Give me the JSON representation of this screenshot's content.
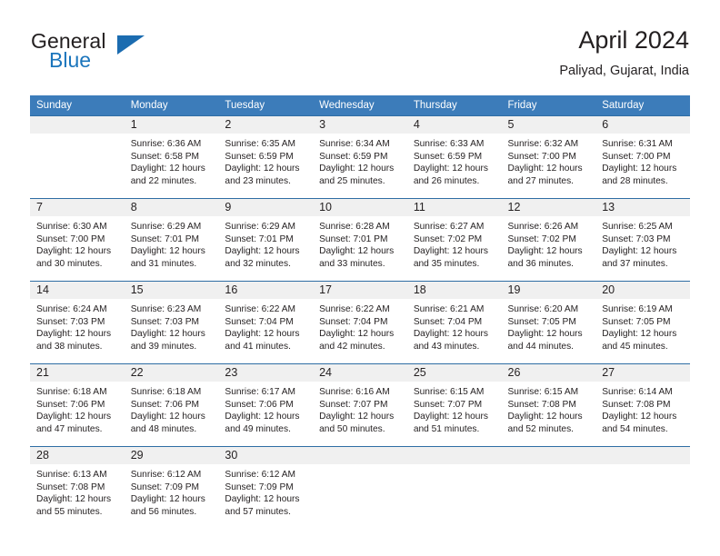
{
  "brand": {
    "name_part1": "General",
    "name_part2": "Blue",
    "logo_icon": "triangle-flag-icon"
  },
  "header": {
    "title": "April 2024",
    "subtitle": "Paliyad, Gujarat, India"
  },
  "calendar": {
    "weekday_headers": [
      "Sunday",
      "Monday",
      "Tuesday",
      "Wednesday",
      "Thursday",
      "Friday",
      "Saturday"
    ],
    "accent_color": "#3c7cba",
    "rule_color": "#2e6da4",
    "daynum_bg": "#f0f0f0",
    "weeks": [
      [
        {
          "day": "",
          "lines": []
        },
        {
          "day": "1",
          "lines": [
            "Sunrise: 6:36 AM",
            "Sunset: 6:58 PM",
            "Daylight: 12 hours",
            "and 22 minutes."
          ]
        },
        {
          "day": "2",
          "lines": [
            "Sunrise: 6:35 AM",
            "Sunset: 6:59 PM",
            "Daylight: 12 hours",
            "and 23 minutes."
          ]
        },
        {
          "day": "3",
          "lines": [
            "Sunrise: 6:34 AM",
            "Sunset: 6:59 PM",
            "Daylight: 12 hours",
            "and 25 minutes."
          ]
        },
        {
          "day": "4",
          "lines": [
            "Sunrise: 6:33 AM",
            "Sunset: 6:59 PM",
            "Daylight: 12 hours",
            "and 26 minutes."
          ]
        },
        {
          "day": "5",
          "lines": [
            "Sunrise: 6:32 AM",
            "Sunset: 7:00 PM",
            "Daylight: 12 hours",
            "and 27 minutes."
          ]
        },
        {
          "day": "6",
          "lines": [
            "Sunrise: 6:31 AM",
            "Sunset: 7:00 PM",
            "Daylight: 12 hours",
            "and 28 minutes."
          ]
        }
      ],
      [
        {
          "day": "7",
          "lines": [
            "Sunrise: 6:30 AM",
            "Sunset: 7:00 PM",
            "Daylight: 12 hours",
            "and 30 minutes."
          ]
        },
        {
          "day": "8",
          "lines": [
            "Sunrise: 6:29 AM",
            "Sunset: 7:01 PM",
            "Daylight: 12 hours",
            "and 31 minutes."
          ]
        },
        {
          "day": "9",
          "lines": [
            "Sunrise: 6:29 AM",
            "Sunset: 7:01 PM",
            "Daylight: 12 hours",
            "and 32 minutes."
          ]
        },
        {
          "day": "10",
          "lines": [
            "Sunrise: 6:28 AM",
            "Sunset: 7:01 PM",
            "Daylight: 12 hours",
            "and 33 minutes."
          ]
        },
        {
          "day": "11",
          "lines": [
            "Sunrise: 6:27 AM",
            "Sunset: 7:02 PM",
            "Daylight: 12 hours",
            "and 35 minutes."
          ]
        },
        {
          "day": "12",
          "lines": [
            "Sunrise: 6:26 AM",
            "Sunset: 7:02 PM",
            "Daylight: 12 hours",
            "and 36 minutes."
          ]
        },
        {
          "day": "13",
          "lines": [
            "Sunrise: 6:25 AM",
            "Sunset: 7:03 PM",
            "Daylight: 12 hours",
            "and 37 minutes."
          ]
        }
      ],
      [
        {
          "day": "14",
          "lines": [
            "Sunrise: 6:24 AM",
            "Sunset: 7:03 PM",
            "Daylight: 12 hours",
            "and 38 minutes."
          ]
        },
        {
          "day": "15",
          "lines": [
            "Sunrise: 6:23 AM",
            "Sunset: 7:03 PM",
            "Daylight: 12 hours",
            "and 39 minutes."
          ]
        },
        {
          "day": "16",
          "lines": [
            "Sunrise: 6:22 AM",
            "Sunset: 7:04 PM",
            "Daylight: 12 hours",
            "and 41 minutes."
          ]
        },
        {
          "day": "17",
          "lines": [
            "Sunrise: 6:22 AM",
            "Sunset: 7:04 PM",
            "Daylight: 12 hours",
            "and 42 minutes."
          ]
        },
        {
          "day": "18",
          "lines": [
            "Sunrise: 6:21 AM",
            "Sunset: 7:04 PM",
            "Daylight: 12 hours",
            "and 43 minutes."
          ]
        },
        {
          "day": "19",
          "lines": [
            "Sunrise: 6:20 AM",
            "Sunset: 7:05 PM",
            "Daylight: 12 hours",
            "and 44 minutes."
          ]
        },
        {
          "day": "20",
          "lines": [
            "Sunrise: 6:19 AM",
            "Sunset: 7:05 PM",
            "Daylight: 12 hours",
            "and 45 minutes."
          ]
        }
      ],
      [
        {
          "day": "21",
          "lines": [
            "Sunrise: 6:18 AM",
            "Sunset: 7:06 PM",
            "Daylight: 12 hours",
            "and 47 minutes."
          ]
        },
        {
          "day": "22",
          "lines": [
            "Sunrise: 6:18 AM",
            "Sunset: 7:06 PM",
            "Daylight: 12 hours",
            "and 48 minutes."
          ]
        },
        {
          "day": "23",
          "lines": [
            "Sunrise: 6:17 AM",
            "Sunset: 7:06 PM",
            "Daylight: 12 hours",
            "and 49 minutes."
          ]
        },
        {
          "day": "24",
          "lines": [
            "Sunrise: 6:16 AM",
            "Sunset: 7:07 PM",
            "Daylight: 12 hours",
            "and 50 minutes."
          ]
        },
        {
          "day": "25",
          "lines": [
            "Sunrise: 6:15 AM",
            "Sunset: 7:07 PM",
            "Daylight: 12 hours",
            "and 51 minutes."
          ]
        },
        {
          "day": "26",
          "lines": [
            "Sunrise: 6:15 AM",
            "Sunset: 7:08 PM",
            "Daylight: 12 hours",
            "and 52 minutes."
          ]
        },
        {
          "day": "27",
          "lines": [
            "Sunrise: 6:14 AM",
            "Sunset: 7:08 PM",
            "Daylight: 12 hours",
            "and 54 minutes."
          ]
        }
      ],
      [
        {
          "day": "28",
          "lines": [
            "Sunrise: 6:13 AM",
            "Sunset: 7:08 PM",
            "Daylight: 12 hours",
            "and 55 minutes."
          ]
        },
        {
          "day": "29",
          "lines": [
            "Sunrise: 6:12 AM",
            "Sunset: 7:09 PM",
            "Daylight: 12 hours",
            "and 56 minutes."
          ]
        },
        {
          "day": "30",
          "lines": [
            "Sunrise: 6:12 AM",
            "Sunset: 7:09 PM",
            "Daylight: 12 hours",
            "and 57 minutes."
          ]
        },
        {
          "day": "",
          "lines": []
        },
        {
          "day": "",
          "lines": []
        },
        {
          "day": "",
          "lines": []
        },
        {
          "day": "",
          "lines": []
        }
      ]
    ]
  }
}
